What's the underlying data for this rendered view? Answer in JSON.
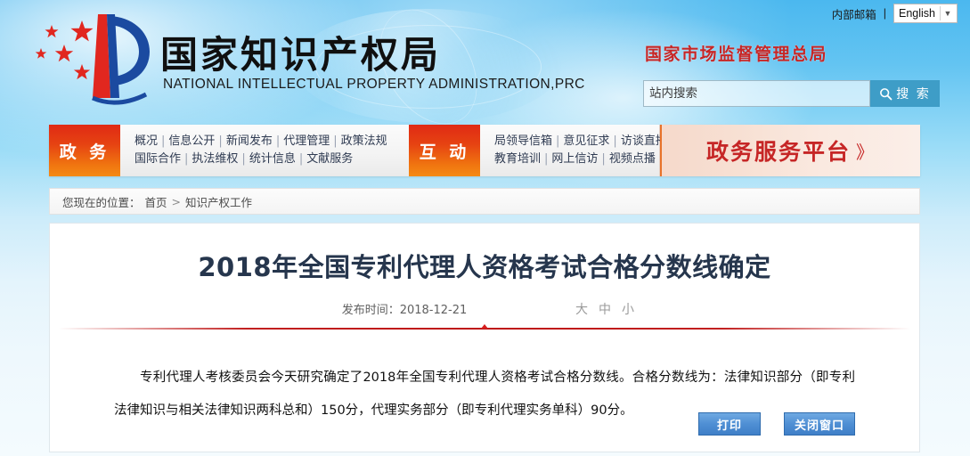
{
  "header": {
    "logo_title": "国家知识产权局",
    "logo_subtitle": "NATIONAL INTELLECTUAL PROPERTY ADMINISTRATION,PRC",
    "mail_link": "内部邮箱",
    "pipe": "|",
    "language": "English",
    "caret": "▼",
    "org_name": "国家市场监督管理总局",
    "search": {
      "placeholder": "站内搜索",
      "value": "",
      "button_label": "搜 索",
      "icon": "search-icon"
    }
  },
  "nav": {
    "groups": [
      {
        "tab": "政 务",
        "row1": [
          "概况",
          "信息公开",
          "新闻发布",
          "代理管理",
          "政策法规"
        ],
        "row2": [
          "国际合作",
          "执法维权",
          "统计信息",
          "文献服务"
        ]
      },
      {
        "tab": "互 动",
        "row1": [
          "局领导信箱",
          "意见征求",
          "访谈直播"
        ],
        "row2": [
          "教育培训",
          "网上信访",
          "视频点播"
        ]
      }
    ],
    "separator": "|",
    "platform_label": "政务服务平台",
    "platform_chevron": "》"
  },
  "breadcrumb": {
    "prefix": "您现在的位置：",
    "home": "首页",
    "separator": ">",
    "current": "知识产权工作"
  },
  "article": {
    "title": "2018年全国专利代理人资格考试合格分数线确定",
    "date_label": "发布时间：",
    "date_value": "2018-12-21",
    "font_sizes": [
      "大",
      "中",
      "小"
    ],
    "body": "专利代理人考核委员会今天研究确定了2018年全国专利代理人资格考试合格分数线。合格分数线为：法律知识部分（即专利法律知识与相关法律知识两科总和）150分，代理实务部分（即专利代理实务单科）90分。",
    "print_button": "打印",
    "close_button": "关闭窗口"
  },
  "colors": {
    "accent_red": "#c62626",
    "nav_orange": "#e8722a",
    "button_blue": "#4f8fd4",
    "search_blue": "#3e9dc7",
    "title_navy": "#26364d"
  }
}
